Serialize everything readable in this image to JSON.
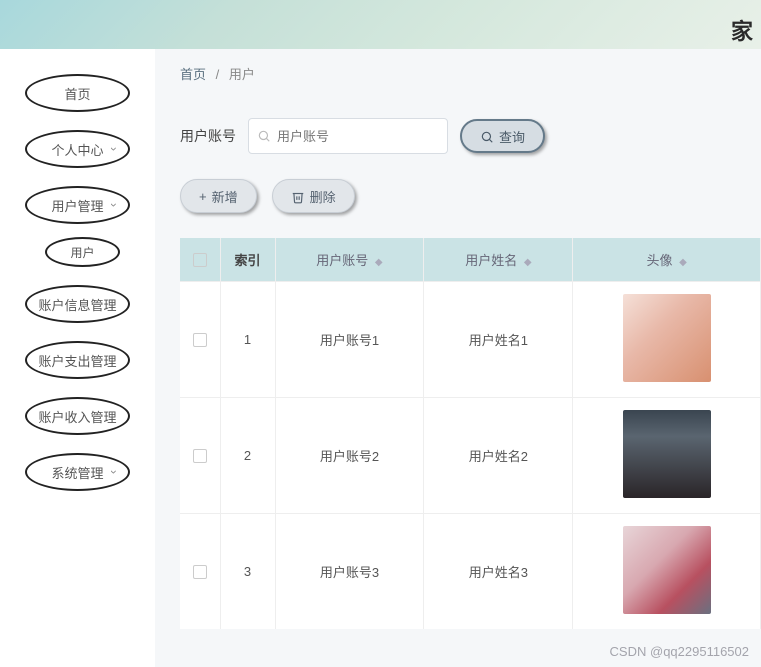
{
  "header": {
    "title_fragment": "家"
  },
  "sidebar": {
    "items": [
      {
        "label": "首页",
        "has_chevron": false
      },
      {
        "label": "个人中心",
        "has_chevron": true
      },
      {
        "label": "用户管理",
        "has_chevron": true
      },
      {
        "label": "账户信息管理",
        "has_chevron": false
      },
      {
        "label": "账户支出管理",
        "has_chevron": false
      },
      {
        "label": "账户收入管理",
        "has_chevron": false
      },
      {
        "label": "系统管理",
        "has_chevron": true
      }
    ],
    "sub_item": {
      "label": "用户"
    }
  },
  "breadcrumb": {
    "home": "首页",
    "current": "用户"
  },
  "filter": {
    "label": "用户账号",
    "placeholder": "用户账号",
    "query_button": "查询"
  },
  "actions": {
    "add": "新增",
    "delete": "删除"
  },
  "table": {
    "headers": {
      "index": "索引",
      "account": "用户账号",
      "name": "用户姓名",
      "avatar": "头像"
    },
    "rows": [
      {
        "index": "1",
        "account": "用户账号1",
        "name": "用户姓名1",
        "avatar_class": "avatar-1"
      },
      {
        "index": "2",
        "account": "用户账号2",
        "name": "用户姓名2",
        "avatar_class": "avatar-2"
      },
      {
        "index": "3",
        "account": "用户账号3",
        "name": "用户姓名3",
        "avatar_class": "avatar-3"
      }
    ]
  },
  "watermark": "CSDN @qq2295116502"
}
